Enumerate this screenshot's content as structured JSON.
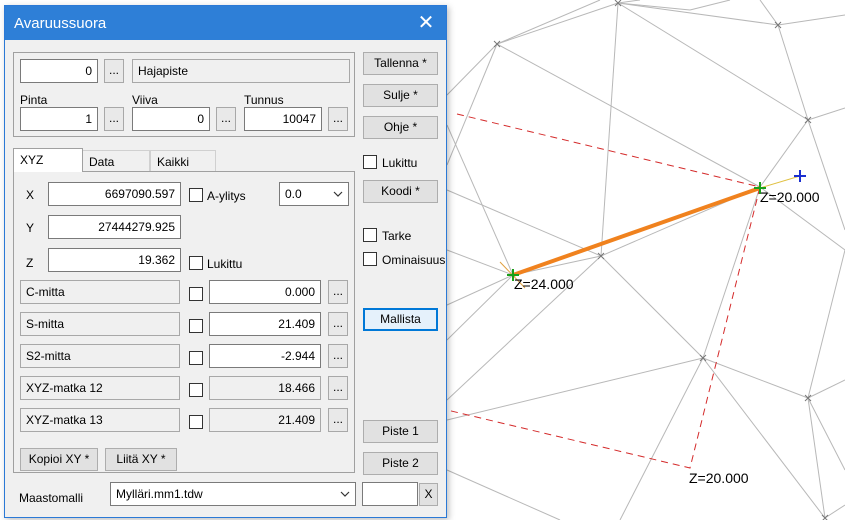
{
  "canvas": {
    "z_labels": [
      "Z=20.000",
      "Z=24.000",
      "Z=20.000"
    ],
    "colors": {
      "line": "#f0821e",
      "dashed": "#d42a2a",
      "mesh": "#b8b8b8",
      "point_green": "#1aa01a",
      "point_blue": "#1a2fd0"
    }
  },
  "dialog": {
    "title": "Avaruussuora",
    "close": "✕",
    "top": {
      "code_value": "0",
      "code_dots": "...",
      "type_text": "Hajapiste",
      "pinta_label": "Pinta",
      "pinta_value": "1",
      "viiva_label": "Viiva",
      "viiva_value": "0",
      "tunnus_label": "Tunnus",
      "tunnus_value": "10047",
      "dots": "..."
    },
    "tabs": [
      "XYZ",
      "Data",
      "Kaikki"
    ],
    "xyz": {
      "x_label": "X",
      "x_value": "6697090.597",
      "y_label": "Y",
      "y_value": "27444279.925",
      "z_label": "Z",
      "z_value": "19.362",
      "aylitys_label": "A-ylitys",
      "aylitys_option": "0.0",
      "lukittu_label": "Lukittu"
    },
    "measures": [
      {
        "label": "C-mitta",
        "value": "0.000"
      },
      {
        "label": "S-mitta",
        "value": "21.409"
      },
      {
        "label": "S2-mitta",
        "value": "-2.944"
      },
      {
        "label": "XYZ-matka 12",
        "value": "18.466"
      },
      {
        "label": "XYZ-matka 13",
        "value": "21.409"
      }
    ],
    "kopioi": "Kopioi XY *",
    "liita": "Liitä XY *",
    "right": {
      "tallenna": "Tallenna *",
      "sulje": "Sulje *",
      "ohje": "Ohje *",
      "lukittu": "Lukittu",
      "koodi": "Koodi *",
      "tarke": "Tarke",
      "ominaisuus": "Ominaisuus",
      "mallista": "Mallista",
      "piste1": "Piste 1",
      "piste2": "Piste 2"
    },
    "footer": {
      "maastomalli_label": "Maastomalli",
      "maastomalli_value": "Mylläri.mm1.tdw",
      "x_button": "X"
    }
  }
}
